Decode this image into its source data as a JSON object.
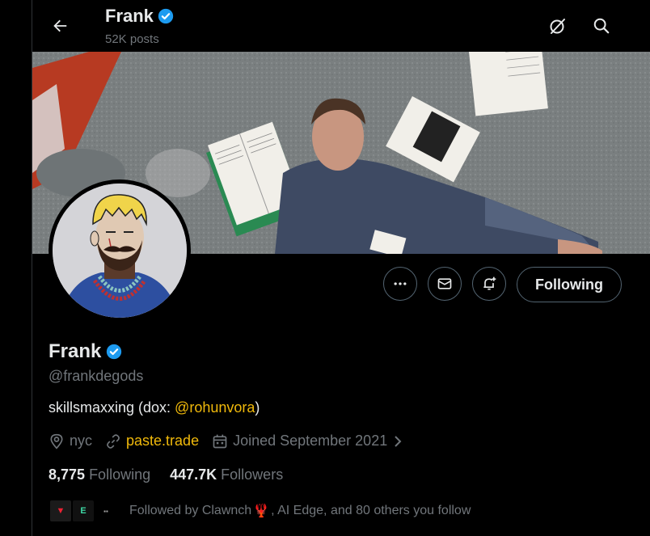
{
  "header": {
    "name": "Frank",
    "posts": "52K posts",
    "back_icon": "arrow-left-icon",
    "grok_icon": "grok-icon",
    "search_icon": "search-icon"
  },
  "profile": {
    "name": "Frank",
    "handle": "@frankdegods",
    "bio_text": "skillsmaxxing (dox: ",
    "bio_link": "@rohunvora",
    "bio_end": ")",
    "location": "nyc",
    "website": "paste.trade",
    "joined": "Joined September 2021"
  },
  "actions": {
    "more_icon": "more-icon",
    "message_icon": "mail-icon",
    "notify_icon": "bell-plus-icon",
    "follow_label": "Following"
  },
  "stats": {
    "following_count": "8,775",
    "following_label": "Following",
    "followers_count": "447.7K",
    "followers_label": "Followers"
  },
  "followed_by": {
    "text_1": "Followed by Clawnch",
    "emoji": "🦞",
    "text_2": ", AI Edge, and 80 others you follow"
  },
  "colors": {
    "accent_link": "#f0b90b",
    "verified": "#1d9bf0",
    "muted": "#71767b"
  }
}
